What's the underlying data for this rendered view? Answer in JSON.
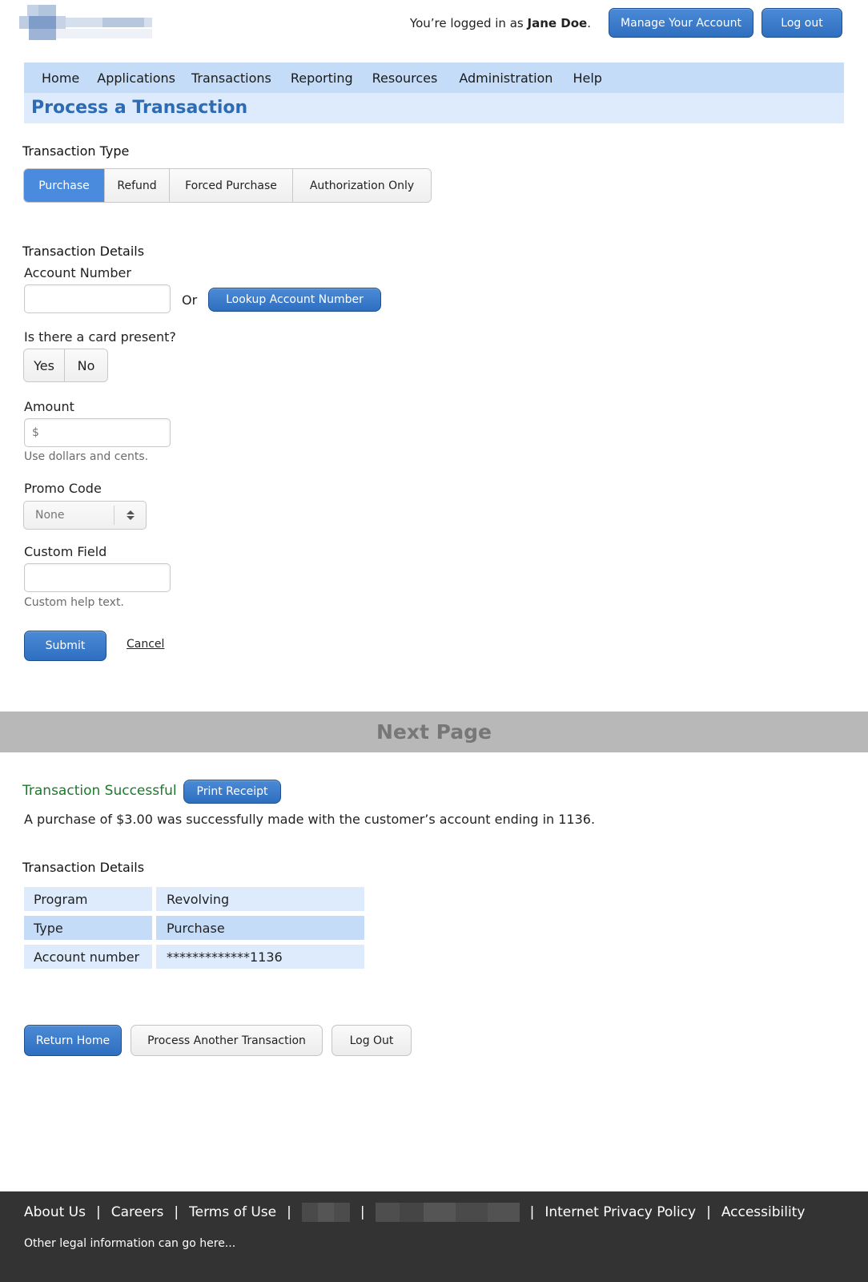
{
  "header": {
    "login_prefix": "You’re logged in as ",
    "user_name": "Jane Doe",
    "login_suffix": ".",
    "manage_account_label": "Manage Your Account",
    "logout_label": "Log out"
  },
  "nav": {
    "items": [
      "Home",
      "Applications",
      "Transactions",
      "Reporting",
      "Resources",
      "Administration",
      "Help"
    ]
  },
  "page_title": "Process a Transaction",
  "transaction_type": {
    "label": "Transaction Type",
    "options": [
      "Purchase",
      "Refund",
      "Forced Purchase",
      "Authorization Only"
    ],
    "selected": "Purchase"
  },
  "form": {
    "section_label": "Transaction Details",
    "account_number_label": "Account Number",
    "account_number_value": "",
    "or_text": "Or",
    "lookup_button": "Lookup Account Number",
    "card_present_label": "Is there a card present?",
    "card_present_options": [
      "Yes",
      "No"
    ],
    "amount_label": "Amount",
    "amount_placeholder": "$",
    "amount_help": "Use dollars and cents.",
    "promo_label": "Promo Code",
    "promo_value": "None",
    "custom_label": "Custom Field",
    "custom_value": "",
    "custom_help": "Custom help text.",
    "submit_label": "Submit",
    "cancel_label": "Cancel"
  },
  "next_page_label": "Next Page",
  "result": {
    "title": "Transaction Successful",
    "print_button": "Print Receipt",
    "message": "A purchase of $3.00 was successfully made with the customer’s account ending in 1136.",
    "details_label": "Transaction Details",
    "rows": [
      {
        "key": "Program",
        "value": "Revolving"
      },
      {
        "key": "Type",
        "value": "Purchase"
      },
      {
        "key": "Account number",
        "value": "*************1136"
      }
    ],
    "return_home": "Return Home",
    "process_another": "Process Another Transaction",
    "log_out": "Log Out"
  },
  "footer": {
    "links": [
      "About Us",
      "Careers",
      "Terms of Use",
      "Internet Privacy Policy",
      "Accessibility"
    ],
    "separator": "|",
    "legal": "Other legal information can go here..."
  },
  "colors": {
    "primary_blue": "#2f6fc0",
    "nav_bg": "#c4dcf8",
    "title_bg": "#ddebfc",
    "title_text": "#2d6bb5",
    "success_green": "#1b7a2a",
    "footer_bg": "#333333"
  }
}
